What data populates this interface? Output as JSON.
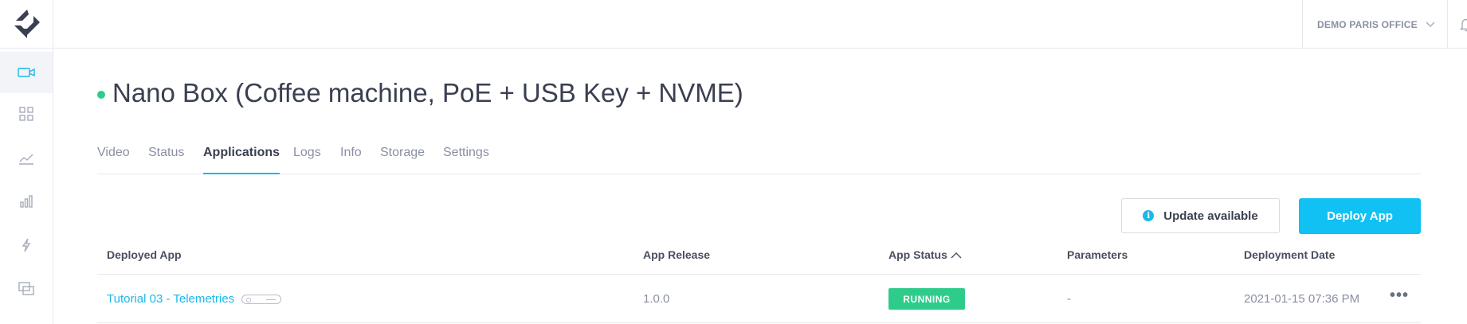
{
  "colors": {
    "accent": "#1bb8ea",
    "deploy_button": "#12c1f3",
    "status_online": "#2ecc8a",
    "running_badge": "#2ecc8a",
    "text_primary": "#3a3f51",
    "text_muted": "#8a8fa3"
  },
  "sidebar": {
    "logo_icon": "brand-logo-icon",
    "items": [
      {
        "icon": "video-camera-icon",
        "active": true
      },
      {
        "icon": "grid-icon",
        "active": false
      },
      {
        "icon": "trend-line-icon",
        "active": false
      },
      {
        "icon": "bar-chart-icon",
        "active": false
      },
      {
        "icon": "lightning-icon",
        "active": false
      },
      {
        "icon": "windows-icon",
        "active": false
      }
    ]
  },
  "header": {
    "org_label": "DEMO PARIS OFFICE",
    "org_icon": "chevron-down-icon",
    "notifications_icon": "bell-icon",
    "user_icon": "user-icon"
  },
  "device": {
    "status": "online",
    "title": "Nano Box (Coffee machine, PoE + USB Key + NVME)"
  },
  "tabs": [
    {
      "label": "Video",
      "active": false
    },
    {
      "label": "Status",
      "active": false
    },
    {
      "label": "Applications",
      "active": true
    },
    {
      "label": "Logs",
      "active": false
    },
    {
      "label": "Info",
      "active": false
    },
    {
      "label": "Storage",
      "active": false
    },
    {
      "label": "Settings",
      "active": false
    }
  ],
  "actions": {
    "update_label": "Update available",
    "update_icon": "info-icon",
    "deploy_label": "Deploy App"
  },
  "table": {
    "columns": [
      "Deployed App",
      "App Release",
      "App Status",
      "Parameters",
      "Deployment Date"
    ],
    "sort_column": "App Status",
    "sort_direction": "ascending",
    "rows": [
      {
        "app": "Tutorial 03 - Telemetries",
        "release": "1.0.0",
        "status": "RUNNING",
        "parameters": "-",
        "date": "2021-01-15 07:36 PM",
        "menu_icon": "more-horizontal-icon"
      }
    ]
  }
}
